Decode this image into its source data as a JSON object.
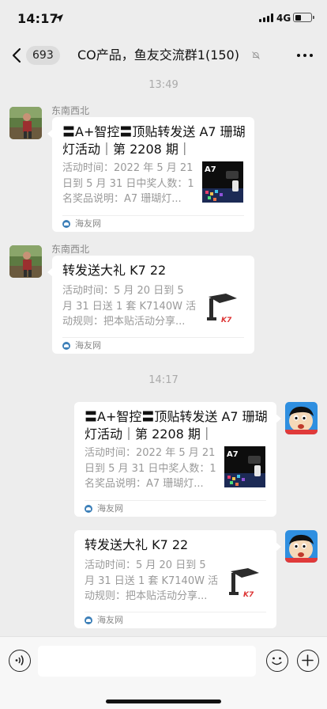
{
  "status_bar": {
    "time": "14:17",
    "network": "4G",
    "battery_level": 0.35
  },
  "nav": {
    "unread_count": "693",
    "title": "CO产品，鱼友交流群1(150)"
  },
  "messages": {
    "time_1": "13:49",
    "time_2": "14:17",
    "m1": {
      "sender": "东南西北",
      "title": "〓A+智控〓顶贴转发送 A7 珊瑚灯活动｜第 2208 期｜",
      "desc": "活动时间：2022 年 5 月 21 日到 5 月 31 日中奖人数：1 名奖品说明：A7 珊瑚灯...",
      "source": "海友网",
      "thumb_text": "A7"
    },
    "m2": {
      "sender": "东南西北",
      "title": "转发送大礼 K7 22",
      "desc": "活动时间：5 月 20 日到 5 月 31 日送 1 套 K7140W 活动规则：把本贴活动分享...",
      "source": "海友网",
      "thumb_text": "K7"
    },
    "m3": {
      "title": "〓A+智控〓顶贴转发送 A7 珊瑚灯活动｜第 2208 期｜",
      "desc": "活动时间：2022 年 5 月 21 日到 5 月 31 日中奖人数：1 名奖品说明：A7 珊瑚灯...",
      "source": "海友网",
      "thumb_text": "A7"
    },
    "m4": {
      "title": "转发送大礼 K7 22",
      "desc": "活动时间：5 月 20 日到 5 月 31 日送 1 套 K7140W 活动规则：把本贴活动分享...",
      "source": "海友网",
      "thumb_text": "K7"
    }
  },
  "colors": {
    "background": "#ededed",
    "card": "#ffffff",
    "meta_text": "#999999",
    "badge_bg": "#dcdcdc"
  },
  "icons": [
    "location-arrow-icon",
    "signal-icon",
    "battery-icon",
    "back-chevron-icon",
    "mute-bell-icon",
    "more-dots-icon",
    "voice-icon",
    "emoji-icon",
    "plus-icon",
    "source-site-icon"
  ]
}
